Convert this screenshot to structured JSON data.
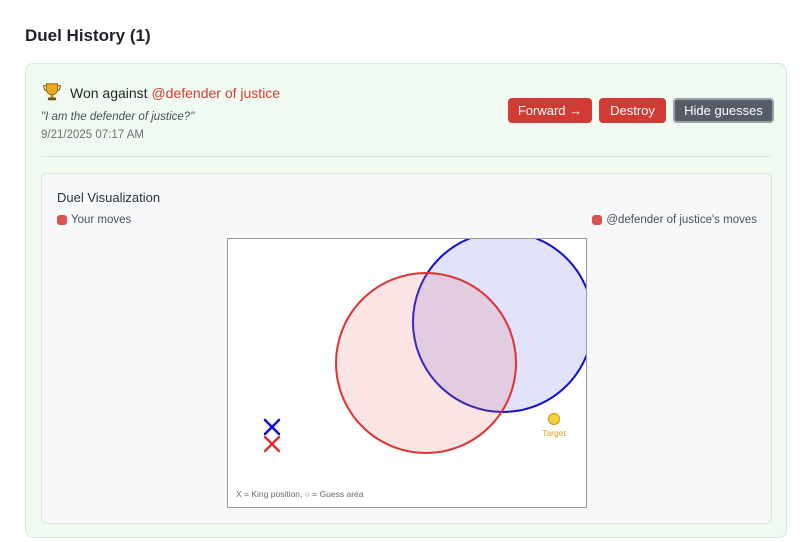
{
  "section": {
    "title": "Duel History (1)"
  },
  "duel": {
    "result_prefix": "Won against",
    "opponent": "@defender of justice",
    "quote": "\"I am the defender of justice?\"",
    "timestamp": "9/21/2025 07:17 AM",
    "result_icon": "trophy-icon",
    "buttons": {
      "forward": "Forward →",
      "destroy": "Destroy",
      "hide_guesses": "Hide guesses"
    }
  },
  "visualization": {
    "title": "Duel Visualization",
    "legend": {
      "yours": "Your moves",
      "opponent": "@defender of justice's moves"
    },
    "target_label": "Target",
    "note": "X = King position, ○ = Guess area",
    "colors": {
      "yours": "#d83a34",
      "opponent": "#1111cc",
      "target": "#f5d23b"
    }
  }
}
